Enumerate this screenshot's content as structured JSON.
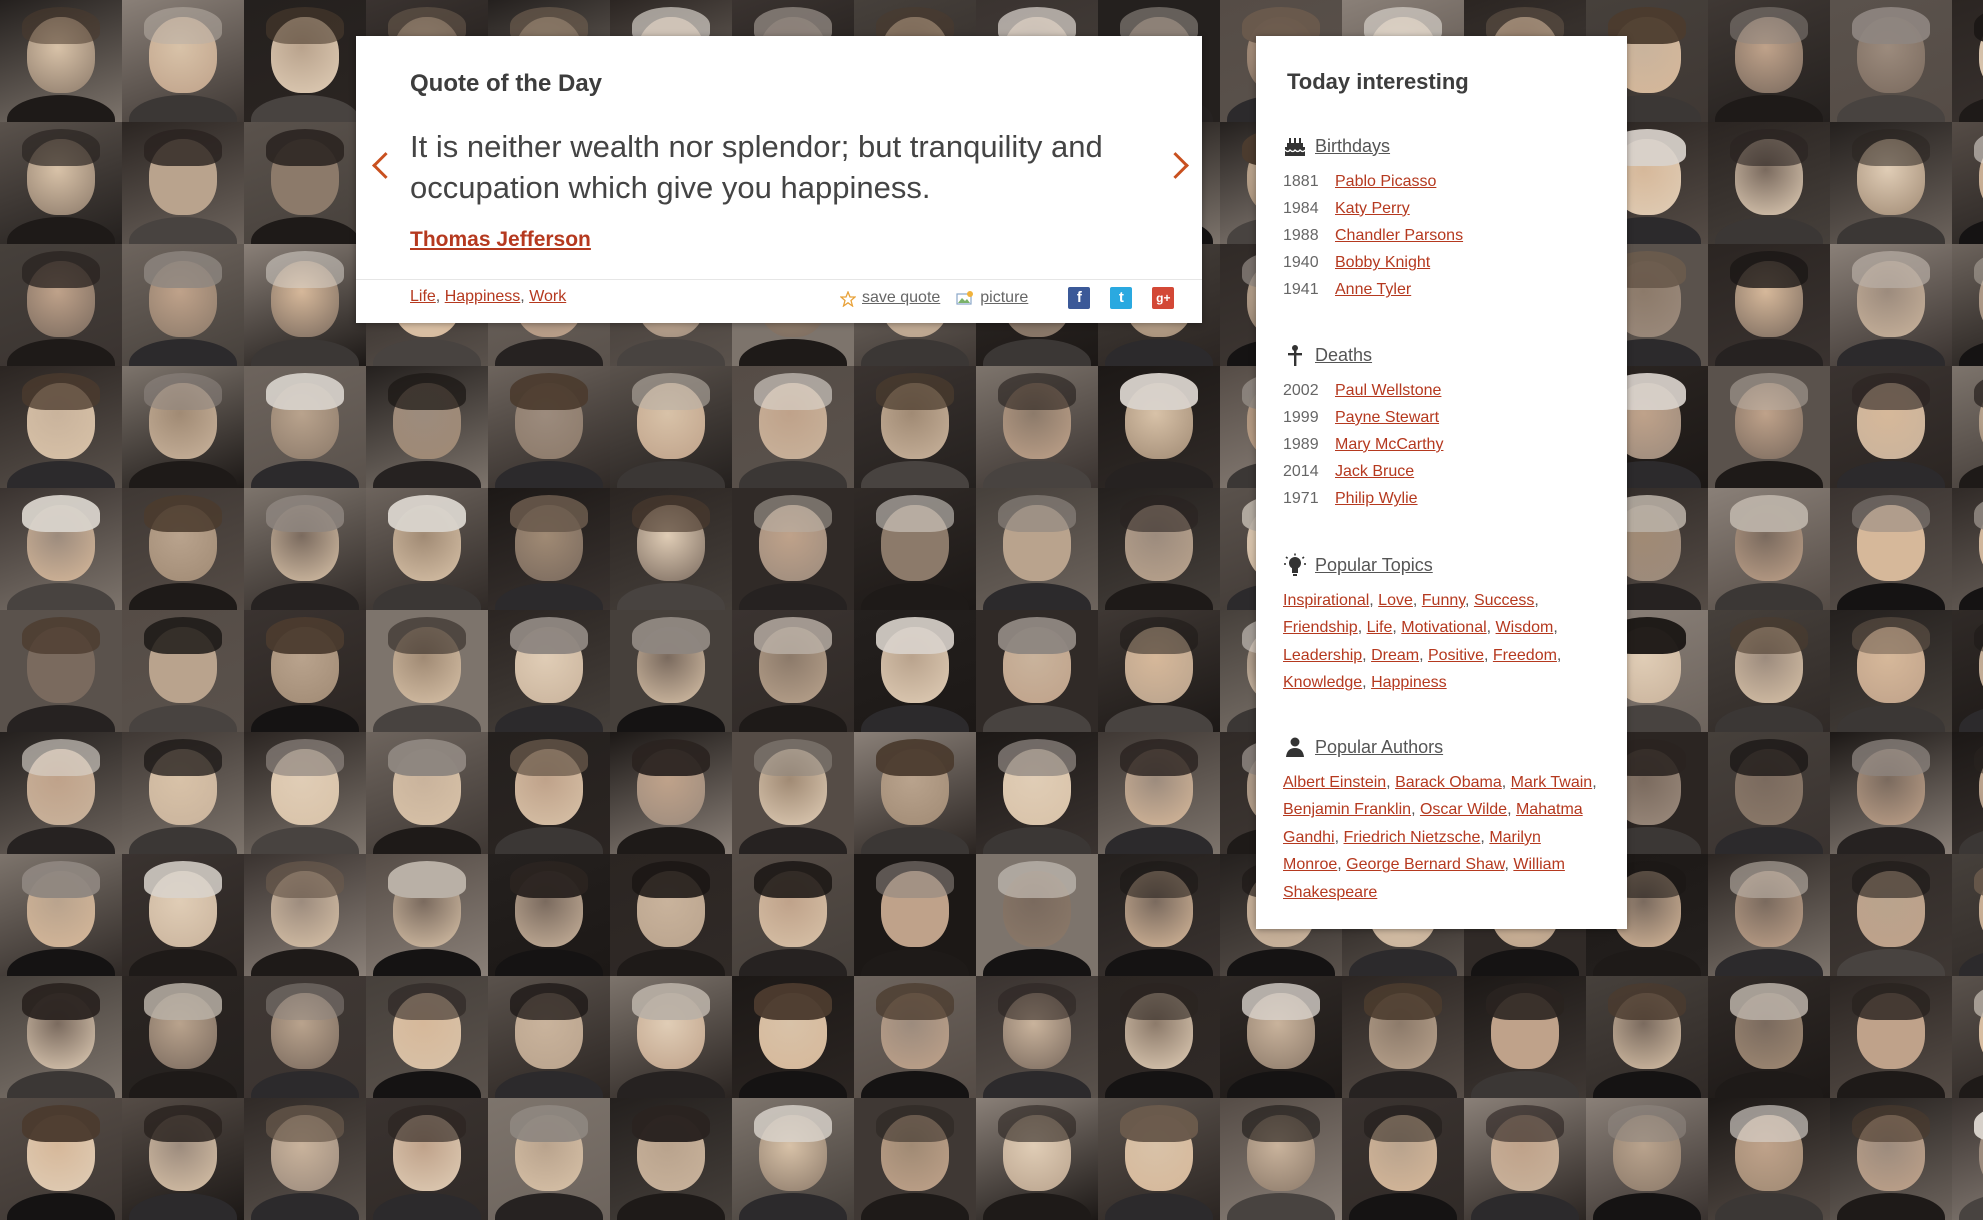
{
  "quote_card": {
    "title": "Quote of the Day",
    "text": "It is neither wealth nor splendor; but tranquility and occupation which give you happiness.",
    "author": "Thomas Jefferson",
    "tags": [
      "Life",
      "Happiness",
      "Work"
    ],
    "save_label": "save quote",
    "picture_label": "picture",
    "social": [
      "f",
      "t",
      "g+"
    ]
  },
  "sidebar": {
    "title": "Today interesting",
    "birthdays": {
      "label": "Birthdays",
      "items": [
        {
          "year": "1881",
          "name": "Pablo Picasso"
        },
        {
          "year": "1984",
          "name": "Katy Perry"
        },
        {
          "year": "1988",
          "name": "Chandler Parsons"
        },
        {
          "year": "1940",
          "name": "Bobby Knight"
        },
        {
          "year": "1941",
          "name": "Anne Tyler"
        }
      ]
    },
    "deaths": {
      "label": "Deaths",
      "items": [
        {
          "year": "2002",
          "name": "Paul Wellstone"
        },
        {
          "year": "1999",
          "name": "Payne Stewart"
        },
        {
          "year": "1989",
          "name": "Mary McCarthy"
        },
        {
          "year": "2014",
          "name": "Jack Bruce"
        },
        {
          "year": "1971",
          "name": "Philip Wylie"
        }
      ]
    },
    "popular_topics": {
      "label": "Popular Topics",
      "items": [
        "Inspirational",
        "Love",
        "Funny",
        "Success",
        "Friendship",
        "Life",
        "Motivational",
        "Wisdom",
        "Leadership",
        "Dream",
        "Positive",
        "Freedom",
        "Knowledge",
        "Happiness"
      ]
    },
    "popular_authors": {
      "label": "Popular Authors",
      "items": [
        "Albert Einstein",
        "Barack Obama",
        "Mark Twain",
        "Benjamin Franklin",
        "Oscar Wilde",
        "Mahatma Gandhi",
        "Friedrich Nietzsche",
        "Marilyn Monroe",
        "George Bernard Shaw",
        "William Shakespeare"
      ]
    }
  },
  "colors": {
    "accent": "#b5391f",
    "arrow": "#c9501f",
    "card_bg": "#ffffff"
  },
  "icons": {
    "prev": "chevron-left-icon",
    "next": "chevron-right-icon",
    "save": "star-icon",
    "picture": "picture-icon",
    "birthdays": "cake-icon",
    "deaths": "cross-icon",
    "topics": "lightbulb-icon",
    "authors": "person-icon"
  }
}
